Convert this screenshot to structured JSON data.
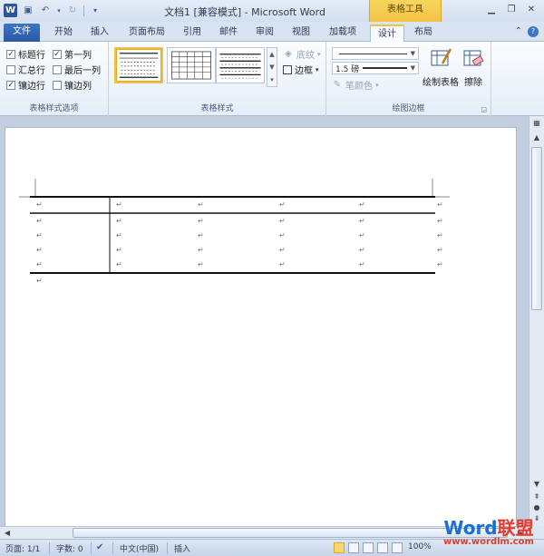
{
  "window": {
    "title": "文档1 [兼容模式] - Microsoft Word",
    "context_tab_group": "表格工具",
    "qat": {
      "logo": "W"
    }
  },
  "tabs": [
    {
      "label": "文件"
    },
    {
      "label": "开始"
    },
    {
      "label": "插入"
    },
    {
      "label": "页面布局"
    },
    {
      "label": "引用"
    },
    {
      "label": "邮件"
    },
    {
      "label": "审阅"
    },
    {
      "label": "视图"
    },
    {
      "label": "加载项"
    },
    {
      "label": "设计"
    },
    {
      "label": "布局"
    }
  ],
  "active_tab": "设计",
  "ribbon": {
    "style_options": {
      "label": "表格样式选项",
      "items": [
        {
          "label": "标题行",
          "checked": true
        },
        {
          "label": "第一列",
          "checked": true
        },
        {
          "label": "汇总行",
          "checked": false
        },
        {
          "label": "最后一列",
          "checked": false
        },
        {
          "label": "镶边行",
          "checked": true
        },
        {
          "label": "镶边列",
          "checked": false
        }
      ]
    },
    "table_styles": {
      "label": "表格样式",
      "shading": "底纹",
      "borders": "边框"
    },
    "draw_borders": {
      "label": "绘图边框",
      "pen_weight": "1.5 磅",
      "pen_color": "笔颜色",
      "draw_table": "绘制表格",
      "eraser": "擦除"
    }
  },
  "document": {
    "paragraph_mark": "↵",
    "table": {
      "rows": 5,
      "cols": 5
    }
  },
  "statusbar": {
    "page": "页面: 1/1",
    "words": "字数: 0",
    "language": "中文(中国)",
    "mode": "插入",
    "zoom": "100%"
  },
  "watermark": {
    "brand_a": "Word",
    "brand_b": "联盟",
    "url": "www.wordlm.com"
  },
  "colors": {
    "accent": "#2a5aa4",
    "context": "#f2c343"
  }
}
